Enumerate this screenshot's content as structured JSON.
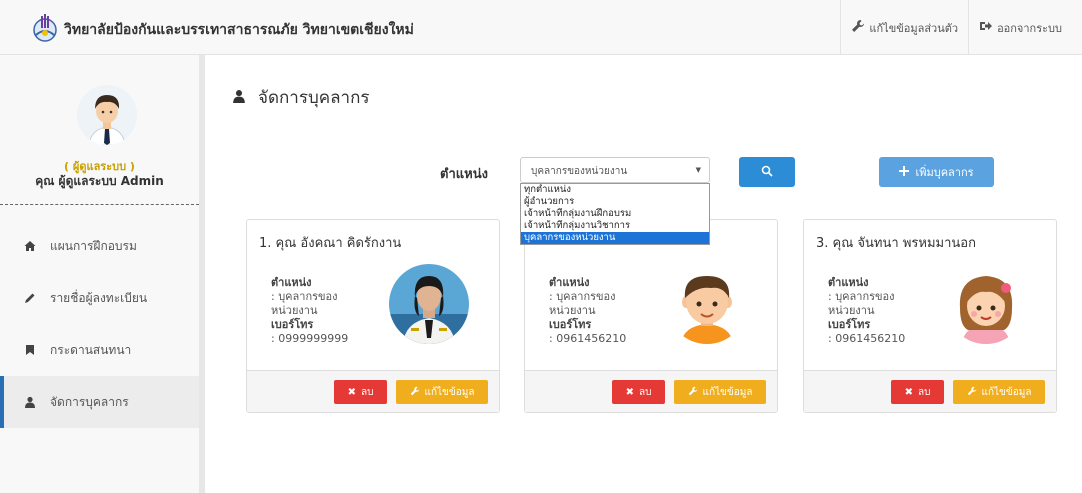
{
  "header": {
    "site_title": "วิทยาลัยป้องกันและบรรเทาสาธารณภัย วิทยาเขตเชียงใหม่",
    "edit_profile_label": "แก้ไขข้อมูลส่วนตัว",
    "logout_label": "ออกจากระบบ"
  },
  "sidebar": {
    "role_label": "( ผู้ดูแลระบบ )",
    "user_name": "คุณ ผู้ดูแลระบบ Admin",
    "items": [
      {
        "label": "แผนการฝึกอบรม",
        "icon": "home-icon"
      },
      {
        "label": "รายชื่อผู้ลงทะเบียน",
        "icon": "pencil-icon"
      },
      {
        "label": "กระดานสนทนา",
        "icon": "bookmark-icon"
      },
      {
        "label": "จัดการบุคลากร",
        "icon": "user-icon"
      }
    ],
    "active_index": 3
  },
  "main": {
    "page_title": "จัดการบุคลากร",
    "filter_label": "ตำแหน่ง",
    "filter_selected": "บุคลากรของหน่วยงาน",
    "filter_options": [
      "ทุกตำแหน่ง",
      "ผู้อำนวยการ",
      "เจ้าหน้าที่กลุ่มงานฝึกอบรม",
      "เจ้าหน้าที่กลุ่มงานวิชาการ",
      "บุคลากรของหน่วยงาน"
    ],
    "add_button_label": "เพิ่มบุคลากร",
    "cards": [
      {
        "title": "1. คุณ อังคณา คิดรักงาน",
        "position_head": "ตำแหน่ง",
        "position_line1": ": บุคลากรของ",
        "position_line2": "หน่วยงาน",
        "phone_head": "เบอร์โทร",
        "phone": ": 0999999999",
        "delete_label": "ลบ",
        "edit_label": "แก้ไขข้อมูล"
      },
      {
        "title": "",
        "position_head": "ตำแหน่ง",
        "position_line1": ": บุคลากรของ",
        "position_line2": "หน่วยงาน",
        "phone_head": "เบอร์โทร",
        "phone": ": 0961456210",
        "delete_label": "ลบ",
        "edit_label": "แก้ไขข้อมูล"
      },
      {
        "title": "3. คุณ จันทนา พรหมมานอก",
        "position_head": "ตำแหน่ง",
        "position_line1": ": บุคลากรของ",
        "position_line2": "หน่วยงาน",
        "phone_head": "เบอร์โทร",
        "phone": ": 0961456210",
        "delete_label": "ลบ",
        "edit_label": "แก้ไขข้อมูล"
      }
    ]
  },
  "colors": {
    "primary": "#2c8cd6",
    "add": "#5ba3e0",
    "danger": "#e53935",
    "warning": "#f0ad1e",
    "role": "#c9a100",
    "selected_option": "#1e74d6"
  }
}
